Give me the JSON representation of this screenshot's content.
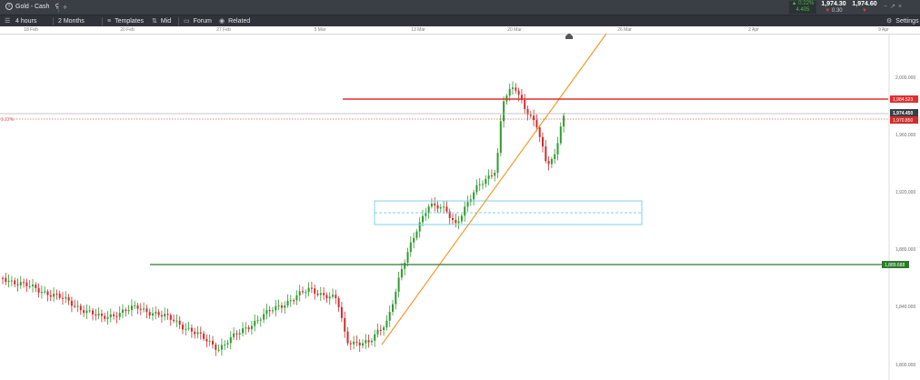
{
  "tab": {
    "title": "Gold - Cash"
  },
  "toolbar": {
    "timeframe": "4 hours",
    "range": "2 Months",
    "templates": "Templates",
    "mid": "Mid",
    "forum": "Forum",
    "related": "Related",
    "settings": "Settings"
  },
  "quote": {
    "change_pct": "0.22%",
    "change_val": "4.405",
    "sell": "1,974.30",
    "spread": "0.30",
    "buy": "1,974.60"
  },
  "chart_data": {
    "type": "candlestick",
    "instrument": "Gold - Cash",
    "interval": "4 hours",
    "time_ticks": [
      "18 Feb",
      "20 Feb",
      "27 Feb",
      "5 Mar",
      "13 Mar",
      "20 Mar",
      "26 Mar",
      "2 Apr",
      "9 Apr"
    ],
    "y_ticks": [
      "2,000.000",
      "1,960.000",
      "1,920.000",
      "1,880.000",
      "1,840.000",
      "1,800.000"
    ],
    "ylim": [
      1800,
      2027
    ],
    "price_labels": {
      "resistance": "1,984.523",
      "current": "1,974.450",
      "sell_line": "1,970.850",
      "support": "1,889.688",
      "left_pct": "1.22%"
    },
    "levels": {
      "resistance": 1984.52,
      "current": 1974.45,
      "sell_line": 1970.85,
      "support": 1889.69,
      "zone_top": 1918,
      "zone_mid": 1911,
      "zone_bottom": 1903
    },
    "trendline": {
      "start_price": 1810,
      "end_price": 2025
    },
    "colors": {
      "up": "#2e9c2e",
      "down": "#d22b2b",
      "trend": "#f29a2e",
      "resistance": "#e03030",
      "support": "#2c7a2c",
      "zone": "#7fd3e8"
    },
    "grid": false
  }
}
